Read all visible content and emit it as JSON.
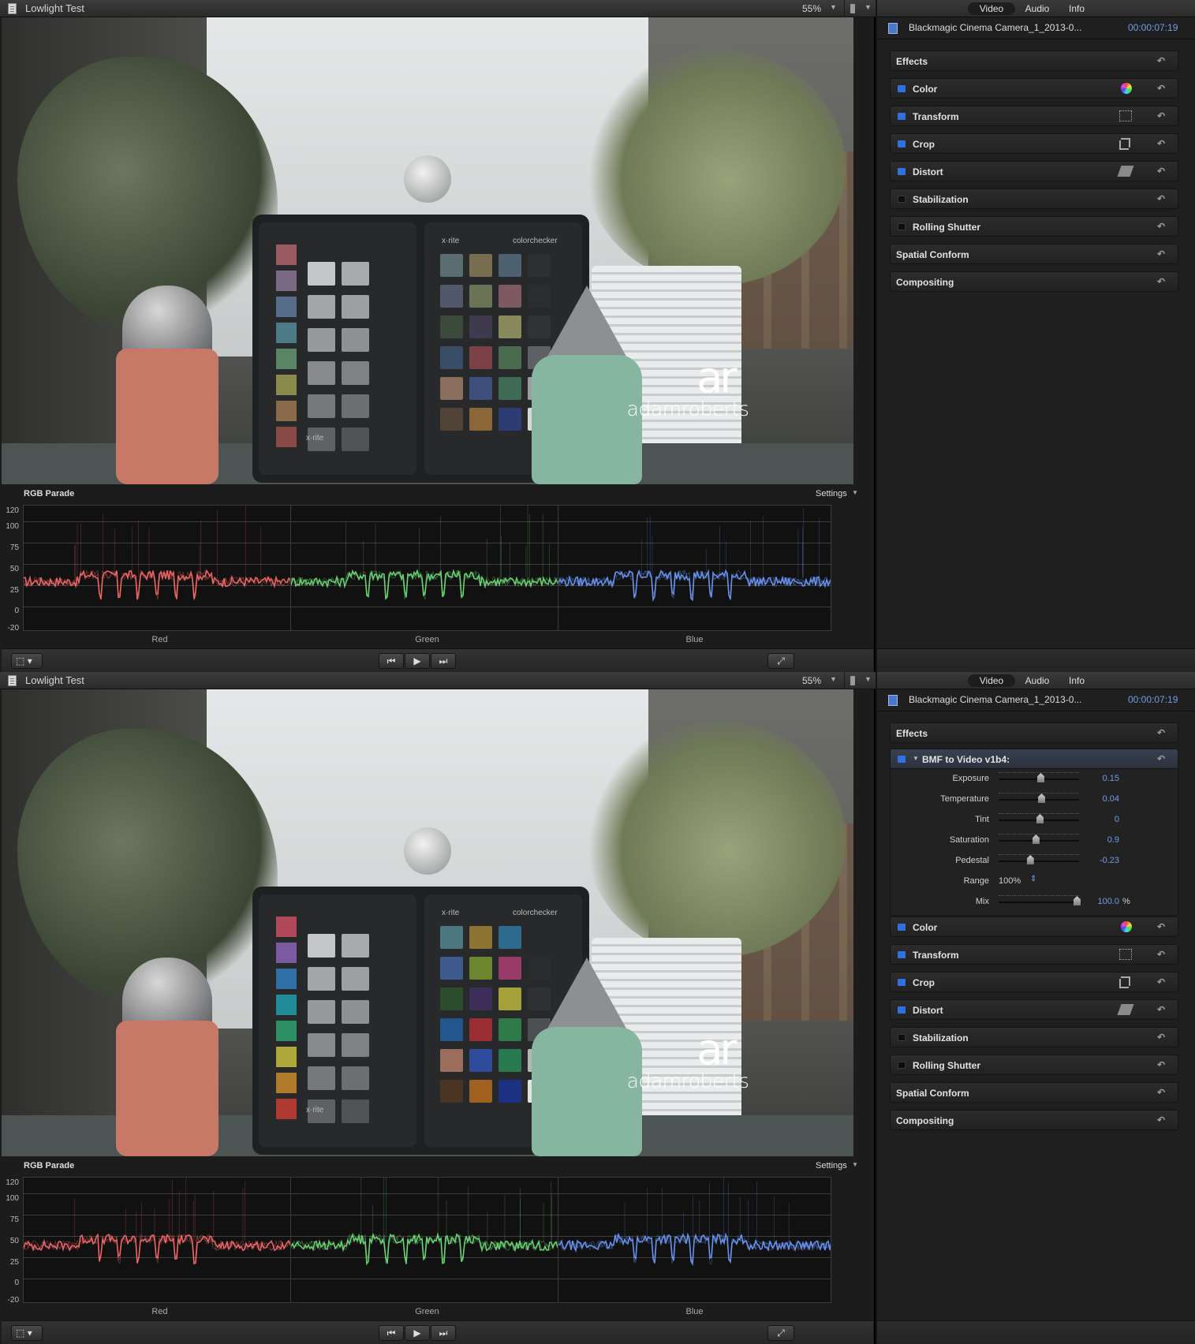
{
  "panes": [
    {
      "id": "top",
      "viewer": {
        "title": "Lowlight Test",
        "zoom": "55%",
        "watermark_logo": "ar",
        "watermark_name": "adamroberts",
        "checker_logo_left": "x·rite",
        "checker_logo_right": "colorchecker"
      },
      "scope": {
        "label": "RGB Parade",
        "settings": "Settings",
        "axis": [
          "120",
          "100",
          "75",
          "50",
          "25",
          "0",
          "-20"
        ],
        "channels": [
          {
            "name": "Red",
            "color": "#ff6b6b"
          },
          {
            "name": "Green",
            "color": "#72e07a"
          },
          {
            "name": "Blue",
            "color": "#6e9cff"
          }
        ],
        "waveform_baseline": 35
      },
      "inspector": {
        "tabs": [
          "Video",
          "Audio",
          "Info"
        ],
        "clip_name": "Blackmagic Cinema Camera_1_2013-0...",
        "timecode": "00:00:07:19",
        "effects_label": "Effects",
        "effect": null,
        "rows": [
          {
            "label": "Color",
            "checkbox": true,
            "icon": "color-wheel-icon"
          },
          {
            "label": "Transform",
            "checkbox": true,
            "icon": "transform-icon"
          },
          {
            "label": "Crop",
            "checkbox": true,
            "icon": "crop-icon"
          },
          {
            "label": "Distort",
            "checkbox": true,
            "icon": "distort-icon"
          },
          {
            "label": "Stabilization",
            "checkbox": false,
            "icon": null
          },
          {
            "label": "Rolling Shutter",
            "checkbox": false,
            "icon": null
          },
          {
            "label": "Spatial Conform",
            "checkbox": null,
            "icon": null
          },
          {
            "label": "Compositing",
            "checkbox": null,
            "icon": null
          }
        ]
      }
    },
    {
      "id": "bottom",
      "viewer": {
        "title": "Lowlight Test",
        "zoom": "55%",
        "watermark_logo": "ar",
        "watermark_name": "adamroberts",
        "checker_logo_left": "x·rite",
        "checker_logo_right": "colorchecker"
      },
      "scope": {
        "label": "RGB Parade",
        "settings": "Settings",
        "axis": [
          "120",
          "100",
          "75",
          "50",
          "25",
          "0",
          "-20"
        ],
        "channels": [
          {
            "name": "Red",
            "color": "#ff6b6b"
          },
          {
            "name": "Green",
            "color": "#72e07a"
          },
          {
            "name": "Blue",
            "color": "#6e9cff"
          }
        ],
        "waveform_baseline": 45
      },
      "inspector": {
        "tabs": [
          "Video",
          "Audio",
          "Info"
        ],
        "clip_name": "Blackmagic Cinema Camera_1_2013-0...",
        "timecode": "00:00:07:19",
        "effects_label": "Effects",
        "effect": {
          "name": "BMF to Video v1b4:",
          "params": [
            {
              "label": "Exposure",
              "value": "0.15",
              "slider_position": 0.52
            },
            {
              "label": "Temperature",
              "value": "0.04",
              "slider_position": 0.53
            },
            {
              "label": "Tint",
              "value": "0",
              "slider_position": 0.51
            },
            {
              "label": "Saturation",
              "value": "0.9",
              "slider_position": 0.46
            },
            {
              "label": "Pedestal",
              "value": "-0.23",
              "slider_position": 0.39
            },
            {
              "label": "Range",
              "value": "100%",
              "type": "popup"
            },
            {
              "label": "Mix",
              "value": "100.0",
              "unit": "%",
              "slider_position": 0.97
            }
          ]
        },
        "rows": [
          {
            "label": "Color",
            "checkbox": true,
            "icon": "color-wheel-icon"
          },
          {
            "label": "Transform",
            "checkbox": true,
            "icon": "transform-icon"
          },
          {
            "label": "Crop",
            "checkbox": true,
            "icon": "crop-icon"
          },
          {
            "label": "Distort",
            "checkbox": true,
            "icon": "distort-icon"
          },
          {
            "label": "Stabilization",
            "checkbox": false,
            "icon": null
          },
          {
            "label": "Rolling Shutter",
            "checkbox": false,
            "icon": null
          },
          {
            "label": "Spatial Conform",
            "checkbox": null,
            "icon": null
          },
          {
            "label": "Compositing",
            "checkbox": null,
            "icon": null
          }
        ]
      }
    }
  ],
  "transport": {
    "prev": "⏮",
    "play": "▶",
    "next": "⏭",
    "fullscreen": "⤢",
    "view_options": "▾"
  },
  "reset_glyph": "↶"
}
